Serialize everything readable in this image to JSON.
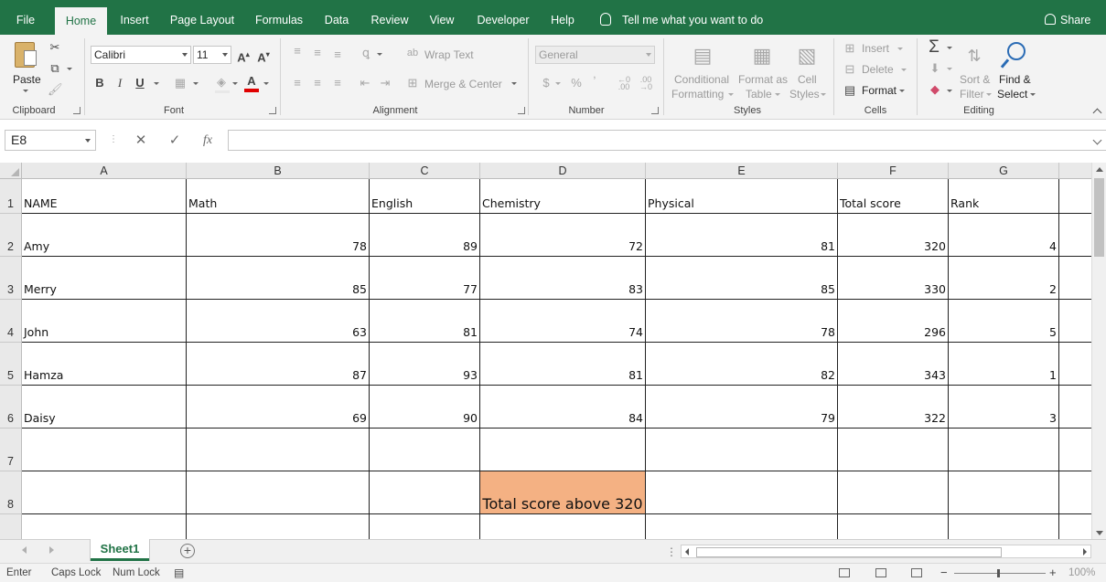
{
  "tabs": [
    {
      "label": "File",
      "active": false
    },
    {
      "label": "Home",
      "active": true
    },
    {
      "label": "Insert",
      "active": false
    },
    {
      "label": "Page Layout",
      "active": false
    },
    {
      "label": "Formulas",
      "active": false
    },
    {
      "label": "Data",
      "active": false
    },
    {
      "label": "Review",
      "active": false
    },
    {
      "label": "View",
      "active": false
    },
    {
      "label": "Developer",
      "active": false
    },
    {
      "label": "Help",
      "active": false
    }
  ],
  "tell_me": "Tell me what you want to do",
  "share": "Share",
  "ribbon": {
    "clipboard": {
      "label": "Clipboard",
      "paste": "Paste"
    },
    "font": {
      "label": "Font",
      "name": "Calibri",
      "size": "11",
      "bold": "B",
      "italic": "I",
      "underline": "U"
    },
    "alignment": {
      "label": "Alignment",
      "wrap_text": "Wrap Text",
      "merge_center": "Merge & Center"
    },
    "number": {
      "label": "Number",
      "format": "General",
      "currency": "$",
      "percent": "%",
      "comma": "ʼ"
    },
    "styles": {
      "label": "Styles",
      "conditional": "Conditional",
      "formatting": "Formatting",
      "format_as": "Format as",
      "table": "Table",
      "cell": "Cell",
      "cell_styles": "Styles"
    },
    "cells": {
      "label": "Cells",
      "insert": "Insert",
      "delete": "Delete",
      "format": "Format"
    },
    "editing": {
      "label": "Editing",
      "sort": "Sort &",
      "filter": "Filter",
      "find": "Find &",
      "select": "Select"
    }
  },
  "formula_bar": {
    "name_box": "E8",
    "formula": "",
    "fx": "fx"
  },
  "sheet": {
    "columns": [
      "A",
      "B",
      "C",
      "D",
      "E",
      "F",
      "G"
    ],
    "row_numbers": [
      "1",
      "2",
      "3",
      "4",
      "5",
      "6",
      "7",
      "8"
    ],
    "header": [
      "NAME",
      "Math",
      "English",
      "Chemistry",
      "Physical",
      "Total score",
      "Rank"
    ],
    "rows": [
      [
        "Amy",
        "78",
        "89",
        "72",
        "81",
        "320",
        "4"
      ],
      [
        "Merry",
        "85",
        "77",
        "83",
        "85",
        "330",
        "2"
      ],
      [
        "John",
        "63",
        "81",
        "74",
        "78",
        "296",
        "5"
      ],
      [
        "Hamza",
        "87",
        "93",
        "81",
        "82",
        "343",
        "1"
      ],
      [
        "Daisy",
        "69",
        "90",
        "84",
        "79",
        "322",
        "3"
      ]
    ],
    "highlight_cell": {
      "text": "Total score above 320",
      "color": "#f4b183"
    }
  },
  "sheet_tab": "Sheet1",
  "status": {
    "mode": "Enter",
    "caps": "Caps Lock",
    "num": "Num Lock",
    "zoom": "100%"
  },
  "colors": {
    "accent": "#217346",
    "ribbon": "#f3f3f3"
  }
}
